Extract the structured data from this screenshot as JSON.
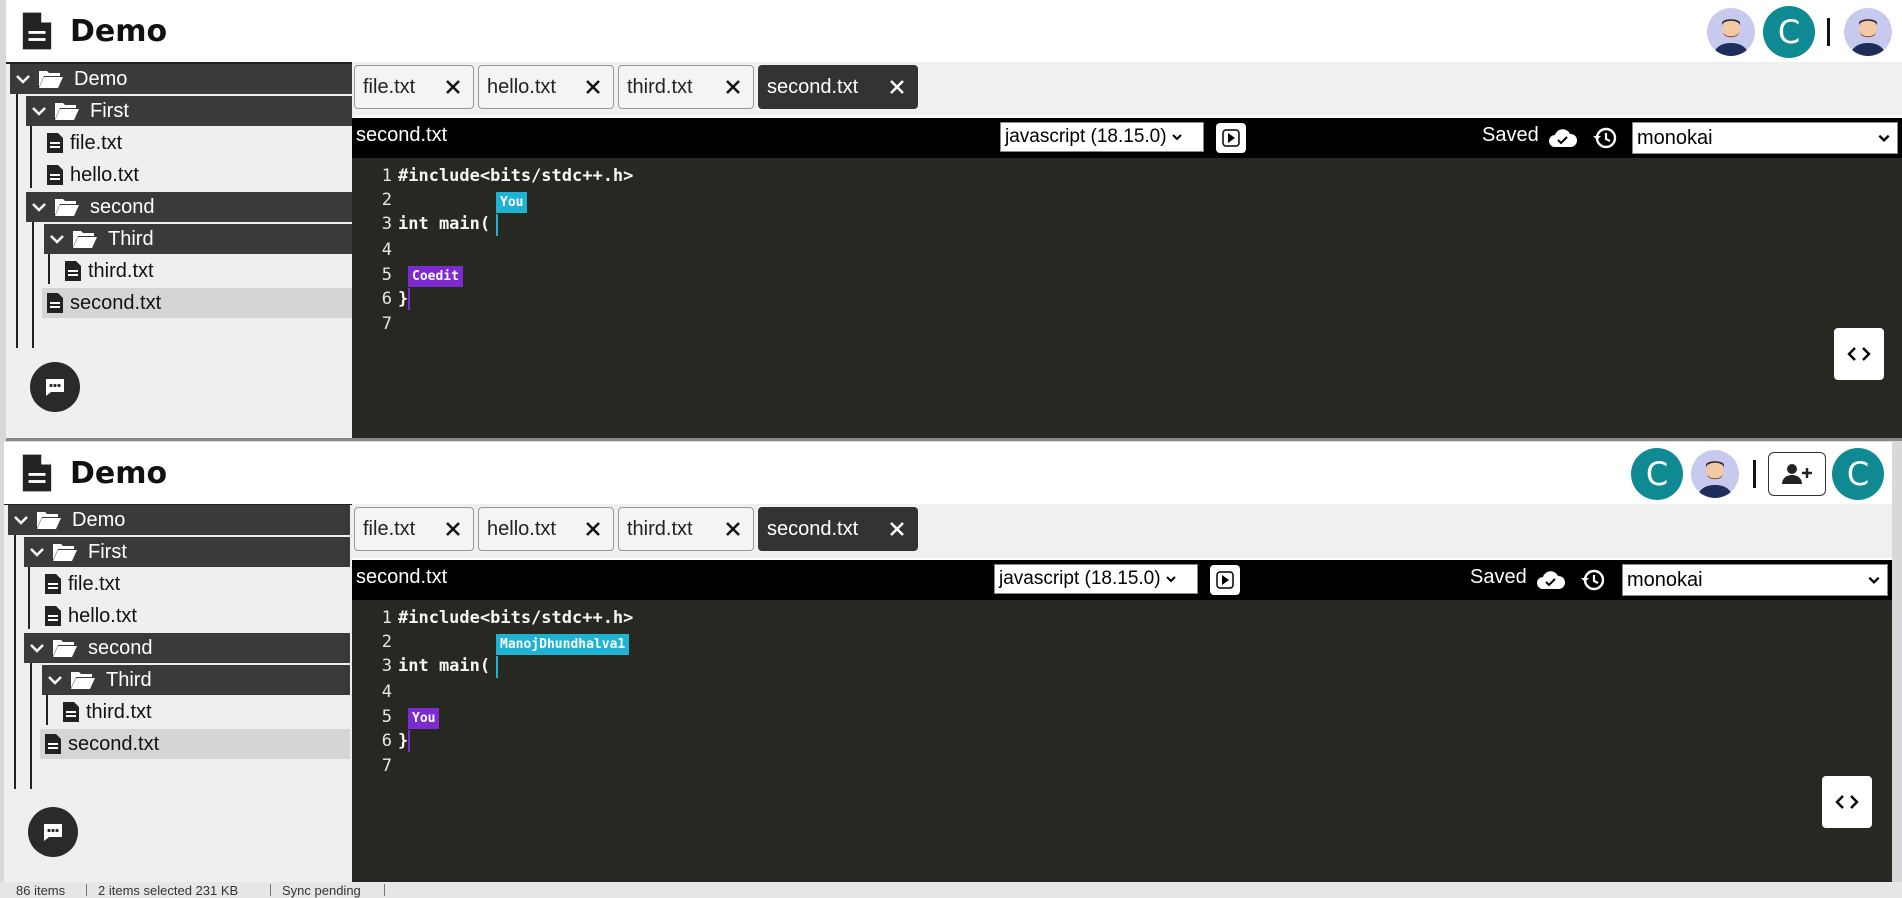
{
  "app": {
    "title": "Demo"
  },
  "top": {
    "tree": {
      "root": "Demo",
      "first": "First",
      "file1": "file.txt",
      "file2": "hello.txt",
      "second": "second",
      "third": "Third",
      "file3": "third.txt",
      "file4": "second.txt"
    },
    "avatars": [
      "avatar",
      "C",
      "avatar"
    ],
    "tabs": [
      "file.txt",
      "hello.txt",
      "third.txt",
      "second.txt"
    ],
    "active_tab": "second.txt",
    "toolbar": {
      "filename": "second.txt",
      "language": "javascript (18.15.0)",
      "saved": "Saved",
      "theme": "monokai"
    },
    "code": [
      "#include<bits/stdc++.h>",
      "",
      "int main(",
      "",
      "",
      "}",
      ""
    ],
    "line_numbers": [
      "1",
      "2",
      "3",
      "4",
      "5",
      "6",
      "7"
    ],
    "cursors": [
      {
        "label": "You",
        "color": "#1fb3d3"
      },
      {
        "label": "Coedit",
        "color": "#7d2bd1"
      }
    ]
  },
  "bottom": {
    "tree": {
      "root": "Demo",
      "first": "First",
      "file1": "file.txt",
      "file2": "hello.txt",
      "second": "second",
      "third": "Third",
      "file3": "third.txt",
      "file4": "second.txt"
    },
    "avatars": [
      "C",
      "avatar",
      "add-user",
      "C"
    ],
    "tabs": [
      "file.txt",
      "hello.txt",
      "third.txt",
      "second.txt"
    ],
    "active_tab": "second.txt",
    "toolbar": {
      "filename": "second.txt",
      "language": "javascript (18.15.0)",
      "saved": "Saved",
      "theme": "monokai"
    },
    "code": [
      "#include<bits/stdc++.h>",
      "",
      "int main(",
      "",
      "",
      "}",
      ""
    ],
    "line_numbers": [
      "1",
      "2",
      "3",
      "4",
      "5",
      "6",
      "7"
    ],
    "cursors": [
      {
        "label": "ManojDhundhalva1",
        "color": "#1fb3d3"
      },
      {
        "label": "You",
        "color": "#7d2bd1"
      }
    ]
  },
  "statusbar": {
    "items": "86 items",
    "selected": "2 items selected  231 KB",
    "sync": "Sync pending"
  },
  "colors": {
    "editor_bg": "#272822",
    "accent_teal": "#0f8a93",
    "cursor_blue": "#1fb3d3",
    "cursor_purple": "#7d2bd1"
  },
  "icons": [
    "file-logo-icon",
    "folder-open-icon",
    "chevron-down-icon",
    "file-icon",
    "close-icon",
    "play-icon",
    "cloud-check-icon",
    "history-icon",
    "chat-icon",
    "code-icon",
    "add-user-icon"
  ]
}
